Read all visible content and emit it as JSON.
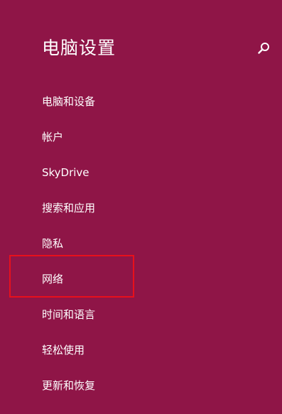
{
  "header": {
    "title": "电脑设置",
    "search_icon": "search-icon"
  },
  "nav": {
    "items": [
      {
        "label": "电脑和设备"
      },
      {
        "label": "帐户"
      },
      {
        "label": "SkyDrive"
      },
      {
        "label": "搜索和应用"
      },
      {
        "label": "隐私"
      },
      {
        "label": "网络",
        "highlighted": true
      },
      {
        "label": "时间和语言"
      },
      {
        "label": "轻松使用"
      },
      {
        "label": "更新和恢复"
      }
    ]
  },
  "colors": {
    "background": "#8f1547",
    "text": "#ffffff",
    "highlight_border": "#e8101c"
  }
}
